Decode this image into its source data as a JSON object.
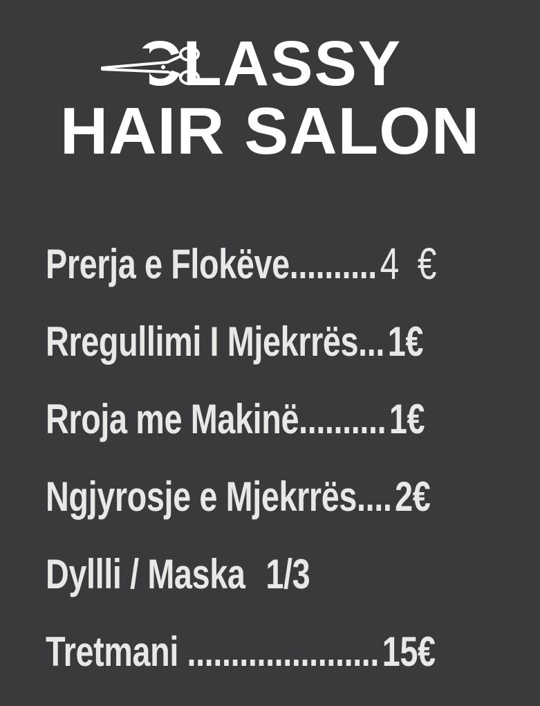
{
  "logo": {
    "line1": "CLASSY",
    "line2": "HAIR SALON",
    "icon": "scissors-icon"
  },
  "menu": {
    "items": [
      {
        "service": "Prerja e Flokëve",
        "leader": "..........",
        "price": "4 €"
      },
      {
        "service": "Rregullimi I Mjekrrës",
        "leader": "...",
        "price": "1€"
      },
      {
        "service": "Rroja me Makinë",
        "leader": "..........",
        "price": "1€"
      },
      {
        "service": "Ngjyrosje e Mjekrrës",
        "leader": "....",
        "price": "2€"
      },
      {
        "service": "Dyllli / Maska",
        "leader": "  ",
        "price": "1/3"
      },
      {
        "service": "Tretmani ",
        "leader": "......................",
        "price": "15€"
      }
    ]
  },
  "colors": {
    "background": "#3a3a3c",
    "text": "#e8e8e6",
    "logo": "#ffffff"
  }
}
